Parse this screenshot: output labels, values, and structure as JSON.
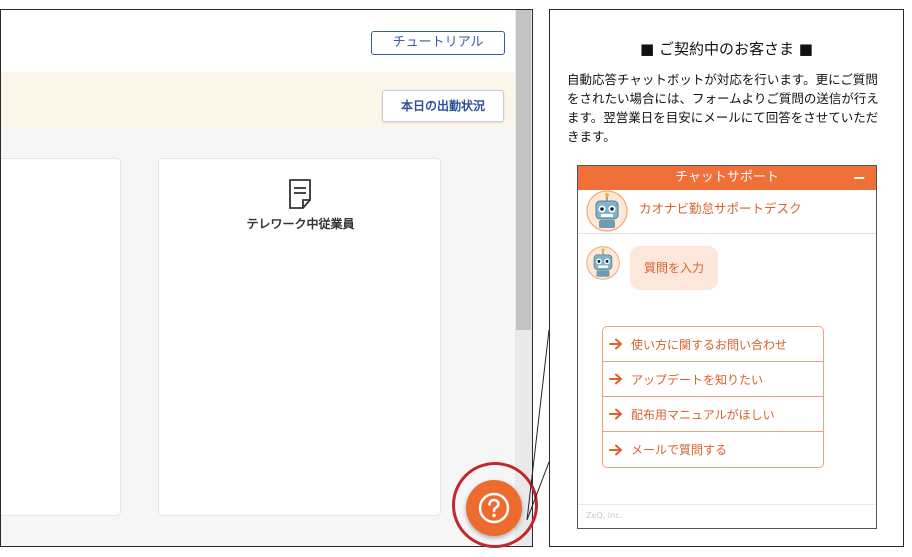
{
  "app": {
    "tutorial_label": "チュートリアル",
    "attendance_label": "本日の出勤状況",
    "telework_label": "テレワーク中従業員",
    "help_icon": "question-mark-icon",
    "doc_icon": "document-icon"
  },
  "info": {
    "heading": "■ ご契約中のお客さま ■",
    "description": "自動応答チャットボットが対応を行います。更にご質問をされたい場合には、フォームよりご質問の送信が行えます。翌営業日を目安にメールにて回答をさせていただきます。"
  },
  "chat": {
    "title": "チャットサポート",
    "minimize": "−",
    "bot_name": "カオナビ勤怠サポートデスク",
    "message": "質問を入力",
    "options": [
      {
        "label": "使い方に関するお問い合わせ"
      },
      {
        "label": "アップデートを知りたい"
      },
      {
        "label": "配布用マニュアルがほしい"
      },
      {
        "label": "メールで質問する"
      }
    ],
    "brand": "ZeQ, Inc."
  },
  "colors": {
    "accent": "#f0703a",
    "fab": "#ee6b2f",
    "highlight": "#c0282d",
    "link_blue": "#3a5aa8"
  }
}
